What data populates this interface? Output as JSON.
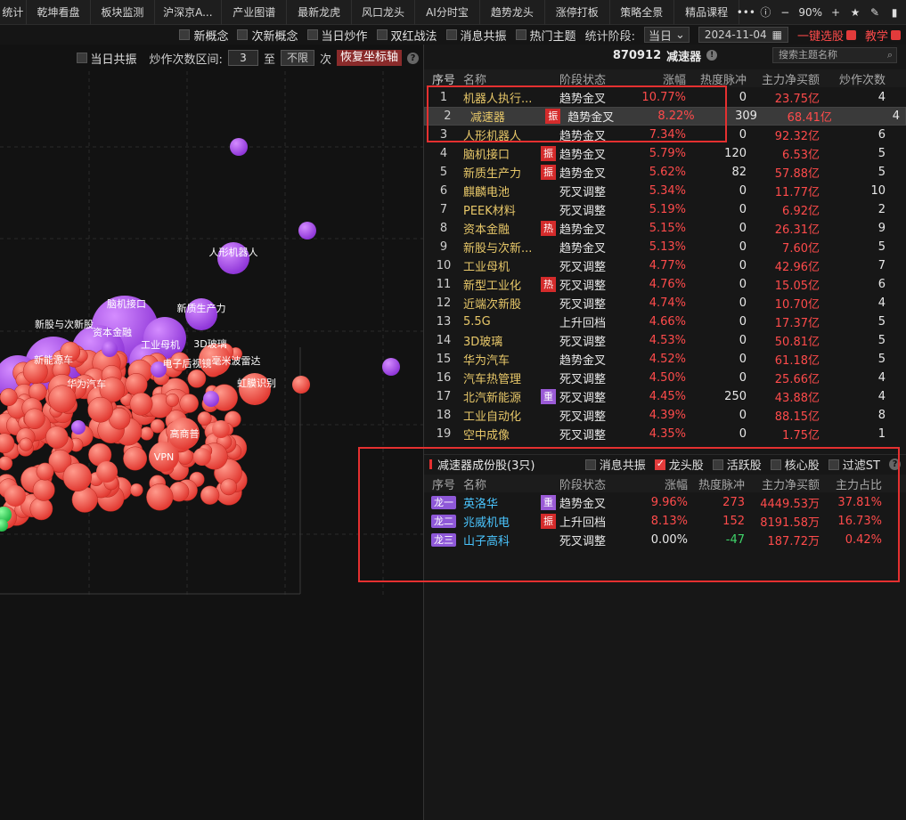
{
  "tabs": [
    "统计",
    "乾坤看盘",
    "板块监测",
    "沪深京A...",
    "产业图谱",
    "最新龙虎",
    "风口龙头",
    "AI分时宝",
    "趋势龙头",
    "涨停打板",
    "策略全景",
    "精品课程"
  ],
  "topbar": {
    "more": "•••",
    "zoom": "90%",
    "minus": "−",
    "plus": "+",
    "star": "★"
  },
  "filters": {
    "items": [
      "新概念",
      "次新概念",
      "当日炒作",
      "双红战法",
      "消息共振",
      "热门主题"
    ],
    "period_label": "统计阶段:",
    "period_value": "当日",
    "date": "2024-11-04",
    "one_click": "一键选股",
    "tutorial": "教学"
  },
  "left_controls": {
    "same_day": "当日共振",
    "range_label": "炒作次数区间:",
    "min": "3",
    "to": "至",
    "max": "不限",
    "unit": "次",
    "restore": "恢复坐标轴"
  },
  "bubble_labels": [
    "人形机器人",
    "脑机接口",
    "新质生产力",
    "新股与次新股",
    "资本金融",
    "工业母机",
    "3D玻璃",
    "毫米波雷达",
    "电子后视镜",
    "新能源车",
    "VPN",
    "高商普",
    "虹膜识别",
    "华为汽车"
  ],
  "stock": {
    "code": "870912",
    "name": "减速器",
    "search_placeholder": "搜索主题名称"
  },
  "table_headers": [
    "序号",
    "名称",
    "阶段状态",
    "涨幅",
    "热度脉冲",
    "主力净买额",
    "炒作次数"
  ],
  "rows": [
    {
      "idx": "1",
      "name": "机器人执行...",
      "tag": "",
      "stage": "趋势金叉",
      "chg": "10.77%",
      "heat": "0",
      "net": "23.75亿",
      "cnt": "4"
    },
    {
      "idx": "2",
      "name": "减速器",
      "tag": "振",
      "stage": "趋势金叉",
      "chg": "8.22%",
      "heat": "309",
      "net": "68.41亿",
      "cnt": "4"
    },
    {
      "idx": "3",
      "name": "人形机器人",
      "tag": "",
      "stage": "趋势金叉",
      "chg": "7.34%",
      "heat": "0",
      "net": "92.32亿",
      "cnt": "6"
    },
    {
      "idx": "4",
      "name": "脑机接口",
      "tag": "振",
      "stage": "趋势金叉",
      "chg": "5.79%",
      "heat": "120",
      "net": "6.53亿",
      "cnt": "5"
    },
    {
      "idx": "5",
      "name": "新质生产力",
      "tag": "振",
      "stage": "趋势金叉",
      "chg": "5.62%",
      "heat": "82",
      "net": "57.88亿",
      "cnt": "5"
    },
    {
      "idx": "6",
      "name": "麒麟电池",
      "tag": "",
      "stage": "死叉调整",
      "chg": "5.34%",
      "heat": "0",
      "net": "11.77亿",
      "cnt": "10"
    },
    {
      "idx": "7",
      "name": "PEEK材料",
      "tag": "",
      "stage": "死叉调整",
      "chg": "5.19%",
      "heat": "0",
      "net": "6.92亿",
      "cnt": "2"
    },
    {
      "idx": "8",
      "name": "资本金融",
      "tag": "热",
      "stage": "趋势金叉",
      "chg": "5.15%",
      "heat": "0",
      "net": "26.31亿",
      "cnt": "9"
    },
    {
      "idx": "9",
      "name": "新股与次新...",
      "tag": "",
      "stage": "趋势金叉",
      "chg": "5.13%",
      "heat": "0",
      "net": "7.60亿",
      "cnt": "5"
    },
    {
      "idx": "10",
      "name": "工业母机",
      "tag": "",
      "stage": "死叉调整",
      "chg": "4.77%",
      "heat": "0",
      "net": "42.96亿",
      "cnt": "7"
    },
    {
      "idx": "11",
      "name": "新型工业化",
      "tag": "热",
      "stage": "死叉调整",
      "chg": "4.76%",
      "heat": "0",
      "net": "15.05亿",
      "cnt": "6"
    },
    {
      "idx": "12",
      "name": "近端次新股",
      "tag": "",
      "stage": "死叉调整",
      "chg": "4.74%",
      "heat": "0",
      "net": "10.70亿",
      "cnt": "4"
    },
    {
      "idx": "13",
      "name": "5.5G",
      "tag": "",
      "stage": "上升回档",
      "chg": "4.66%",
      "heat": "0",
      "net": "17.37亿",
      "cnt": "5"
    },
    {
      "idx": "14",
      "name": "3D玻璃",
      "tag": "",
      "stage": "死叉调整",
      "chg": "4.53%",
      "heat": "0",
      "net": "50.81亿",
      "cnt": "5"
    },
    {
      "idx": "15",
      "name": "华为汽车",
      "tag": "",
      "stage": "趋势金叉",
      "chg": "4.52%",
      "heat": "0",
      "net": "61.18亿",
      "cnt": "5"
    },
    {
      "idx": "16",
      "name": "汽车热管理",
      "tag": "",
      "stage": "死叉调整",
      "chg": "4.50%",
      "heat": "0",
      "net": "25.66亿",
      "cnt": "4"
    },
    {
      "idx": "17",
      "name": "北汽新能源",
      "tag": "重",
      "stage": "死叉调整",
      "chg": "4.45%",
      "heat": "250",
      "net": "43.88亿",
      "cnt": "4"
    },
    {
      "idx": "18",
      "name": "工业自动化",
      "tag": "",
      "stage": "死叉调整",
      "chg": "4.39%",
      "heat": "0",
      "net": "88.15亿",
      "cnt": "8"
    },
    {
      "idx": "19",
      "name": "空中成像",
      "tag": "",
      "stage": "死叉调整",
      "chg": "4.35%",
      "heat": "0",
      "net": "1.75亿",
      "cnt": "1"
    }
  ],
  "sub": {
    "title": "减速器成份股(3只)",
    "options": [
      "消息共振",
      "龙头股",
      "活跃股",
      "核心股",
      "过滤ST"
    ],
    "checked": [
      false,
      true,
      false,
      false,
      false
    ],
    "headers": [
      "序号",
      "名称",
      "阶段状态",
      "涨幅",
      "热度脉冲",
      "主力净买额",
      "主力占比"
    ],
    "rows": [
      {
        "dragon": "龙一",
        "name": "英洛华",
        "tag": "重",
        "stage": "趋势金叉",
        "chg": "9.96%",
        "heat": "273",
        "net": "4449.53万",
        "ratio": "37.81%"
      },
      {
        "dragon": "龙二",
        "name": "兆威机电",
        "tag": "振",
        "stage": "上升回档",
        "chg": "8.13%",
        "heat": "152",
        "net": "8191.58万",
        "ratio": "16.73%"
      },
      {
        "dragon": "龙三",
        "name": "山子高科",
        "tag": "",
        "stage": "死叉调整",
        "chg": "0.00%",
        "heat": "-47",
        "net": "187.72万",
        "ratio": "0.42%"
      }
    ]
  },
  "colors": {
    "accent_red": "#ff4b4b",
    "bubble_red": "#f0524a",
    "bubble_purple": "#a64de8",
    "bubble_green": "#37d45a",
    "frame_red": "#e53030"
  }
}
